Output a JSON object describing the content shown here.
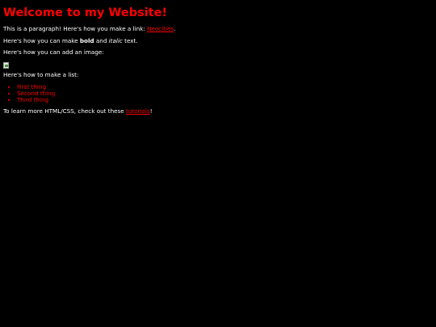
{
  "header": {
    "title": "Welcome to my Website!"
  },
  "intro": {
    "text_before_link": "This is a paragraph! Here's how you make a link: ",
    "link_text": "Neocities",
    "text_after_link": "."
  },
  "formatting": {
    "text_before_bold": "Here's how you can make ",
    "bold_text": "bold",
    "text_between": " and ",
    "italic_text": "italic",
    "text_after_italic": " text."
  },
  "image_section": {
    "text": "Here's how you can add an image:",
    "image_icon": "broken-image-icon"
  },
  "list_section": {
    "text": "Here's how to make a list:",
    "items": [
      "First thing",
      "Second thing",
      "Third thing"
    ]
  },
  "footer": {
    "text_before_link": "To learn more HTML/CSS, check out these ",
    "link_text": "tutorials",
    "text_after_link": "!"
  },
  "colors": {
    "background": "#000000",
    "text": "#ffffff",
    "accent": "#ff0000"
  }
}
